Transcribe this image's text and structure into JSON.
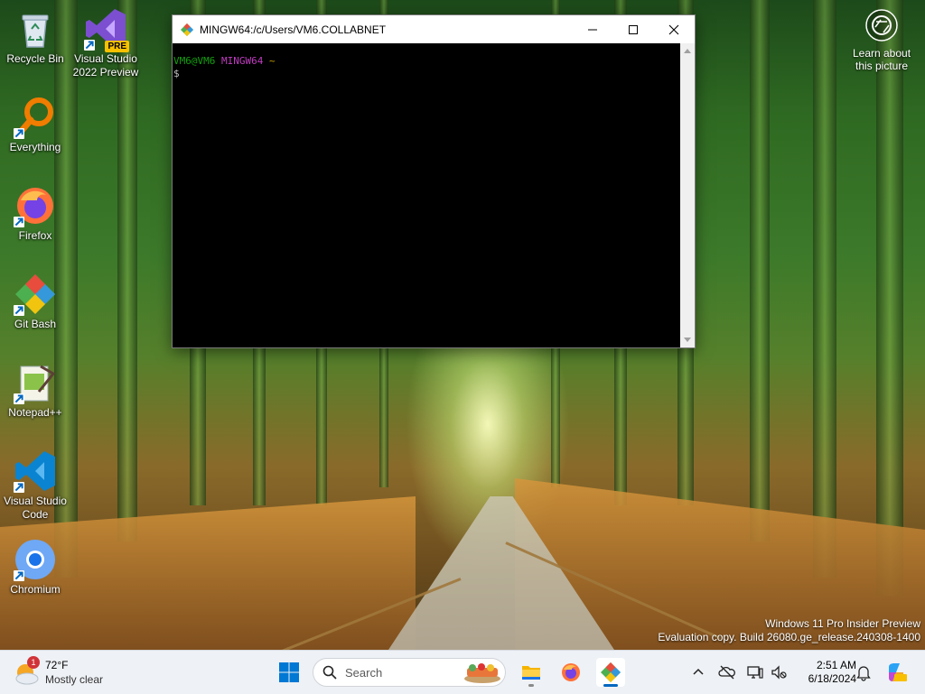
{
  "desktop_icons": [
    {
      "label": "Recycle Bin",
      "icon": "recycle-bin-icon"
    },
    {
      "label": "Visual Studio 2022 Preview",
      "icon": "visual-studio-preview-icon"
    },
    {
      "label": "Everything",
      "icon": "everything-search-icon"
    },
    {
      "label": "Firefox",
      "icon": "firefox-icon"
    },
    {
      "label": "Git Bash",
      "icon": "git-bash-icon"
    },
    {
      "label": "Notepad++",
      "icon": "notepad-plus-plus-icon"
    },
    {
      "label": "Visual Studio Code",
      "icon": "vscode-icon"
    },
    {
      "label": "Chromium",
      "icon": "chromium-icon"
    }
  ],
  "vs_preview_badge": "PRE",
  "terminal": {
    "title": "MINGW64:/c/Users/VM6.COLLABNET",
    "prompt_user": "VM6@VM6",
    "prompt_system": "MINGW64",
    "prompt_dir": "~",
    "prompt_symbol": "$"
  },
  "learn_picture": {
    "line1": "Learn about",
    "line2": "this picture"
  },
  "watermark": {
    "line1": "Windows 11 Pro Insider Preview",
    "line2": "Evaluation copy. Build 26080.ge_release.240308-1400"
  },
  "taskbar": {
    "weather": {
      "temp": "72°F",
      "condition": "Mostly clear",
      "badge": "1"
    },
    "search_placeholder": "Search",
    "pinned": [
      "windows-start-icon",
      "file-explorer-icon",
      "firefox-icon",
      "git-bash-icon"
    ],
    "clock": {
      "time": "2:51 AM",
      "date": "6/18/2024"
    }
  },
  "colors": {
    "taskbar_bg": "#eef1f5",
    "prompt_user": "#13a10e",
    "prompt_system": "#c03cc0",
    "prompt_dir": "#c19c00",
    "accent": "#0067c0"
  }
}
